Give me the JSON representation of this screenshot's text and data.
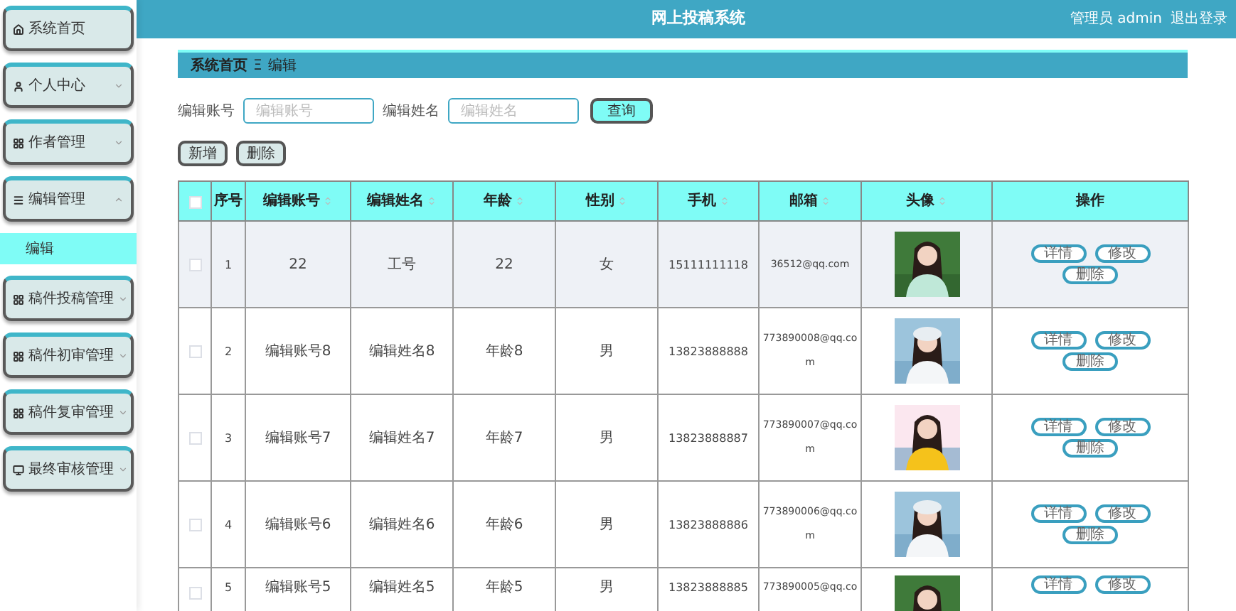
{
  "header": {
    "title": "网上投稿系统",
    "user": "管理员 admin",
    "logout": "退出登录"
  },
  "sidebar": {
    "items": [
      {
        "label": "系统首页",
        "kind": "link"
      },
      {
        "label": "个人中心",
        "kind": "menu",
        "expanded": false
      },
      {
        "label": "作者管理",
        "kind": "menu",
        "expanded": false
      },
      {
        "label": "编辑管理",
        "kind": "menu",
        "expanded": true,
        "children": [
          {
            "label": "编辑",
            "selected": true
          }
        ]
      },
      {
        "label": "稿件投稿管理",
        "kind": "menu",
        "expanded": false
      },
      {
        "label": "稿件初审管理",
        "kind": "menu",
        "expanded": false
      },
      {
        "label": "稿件复审管理",
        "kind": "menu",
        "expanded": false
      },
      {
        "label": "最终审核管理",
        "kind": "menu",
        "expanded": false
      }
    ]
  },
  "breadcrumb": {
    "items": [
      "系统首页",
      "编辑"
    ],
    "separator": "Ξ"
  },
  "search": {
    "fields": [
      {
        "label": "编辑账号",
        "placeholder": "编辑账号"
      },
      {
        "label": "编辑姓名",
        "placeholder": "编辑姓名"
      }
    ],
    "button": "查询"
  },
  "actions": [
    "新增",
    "删除"
  ],
  "table": {
    "select_all": false,
    "columns": [
      {
        "label": "序号",
        "sortable": false
      },
      {
        "label": "编辑账号",
        "sortable": true
      },
      {
        "label": "编辑姓名",
        "sortable": true
      },
      {
        "label": "年龄",
        "sortable": true
      },
      {
        "label": "性别",
        "sortable": true
      },
      {
        "label": "手机",
        "sortable": true
      },
      {
        "label": "邮箱",
        "sortable": true
      },
      {
        "label": "头像",
        "sortable": true
      },
      {
        "label": "操作",
        "sortable": false
      }
    ],
    "rows": [
      {
        "checked": false,
        "hovered": true,
        "cells": [
          "1",
          "22",
          "工号",
          "22",
          "女",
          "15111111118",
          "36512@qq.com"
        ],
        "photo": {
          "kind": "picture"
        },
        "actions": [
          "详情",
          "修改",
          "删除"
        ]
      },
      {
        "checked": false,
        "hovered": false,
        "cells": [
          "2",
          "编辑账号8",
          "编辑姓名8",
          "年龄8",
          "男",
          "13823888888",
          "773890008@qq.com"
        ],
        "photo": {
          "kind": "picture"
        },
        "actions": [
          "详情",
          "修改",
          "删除"
        ]
      },
      {
        "checked": false,
        "hovered": false,
        "cells": [
          "3",
          "编辑账号7",
          "编辑姓名7",
          "年龄7",
          "男",
          "13823888887",
          "773890007@qq.com"
        ],
        "photo": {
          "kind": "picture"
        },
        "actions": [
          "详情",
          "修改",
          "删除"
        ]
      },
      {
        "checked": false,
        "hovered": false,
        "cells": [
          "4",
          "编辑账号6",
          "编辑姓名6",
          "年龄6",
          "男",
          "13823888886",
          "773890006@qq.com"
        ],
        "photo": {
          "kind": "picture"
        },
        "actions": [
          "详情",
          "修改",
          "删除"
        ]
      },
      {
        "checked": false,
        "hovered": false,
        "cells": [
          "5",
          "编辑账号5",
          "编辑姓名5",
          "年龄5",
          "男",
          "13823888885",
          "773890005@qq.co"
        ],
        "photo": {
          "kind": "picture"
        },
        "actions": [
          "详情",
          "修改"
        ]
      }
    ]
  }
}
